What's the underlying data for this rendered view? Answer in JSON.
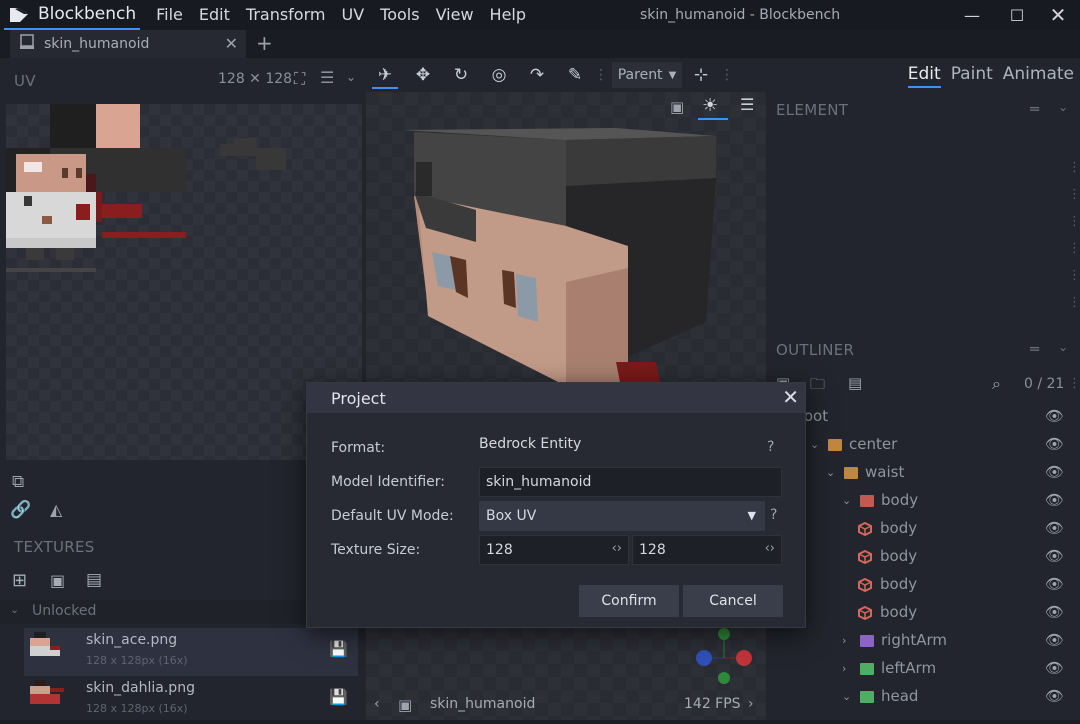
{
  "app": {
    "name": "Blockbench",
    "window_title": "skin_humanoid - Blockbench",
    "menu": [
      "File",
      "Edit",
      "Transform",
      "UV",
      "Tools",
      "View",
      "Help"
    ],
    "accent": "#3e90ff"
  },
  "tab": {
    "label": "skin_humanoid"
  },
  "uv_panel": {
    "title": "UV",
    "size": "128 ✕ 128"
  },
  "toolbar": {
    "pivot_select": "Parent"
  },
  "modes": {
    "edit": "Edit",
    "paint": "Paint",
    "animate": "Animate"
  },
  "element_panel": {
    "title": "ELEMENT"
  },
  "outliner": {
    "title": "OUTLINER",
    "count": "0 / 21",
    "rows": [
      {
        "label": "root",
        "kind": "root",
        "level": 0
      },
      {
        "label": "center",
        "kind": "folder",
        "color": "#c2873f",
        "level": 1
      },
      {
        "label": "waist",
        "kind": "folder",
        "color": "#c2873f",
        "level": 2
      },
      {
        "label": "body",
        "kind": "folder",
        "color": "#c35a4f",
        "level": 3
      },
      {
        "label": "body",
        "kind": "cube",
        "color": "#d2685c",
        "level": 4
      },
      {
        "label": "body",
        "kind": "cube",
        "color": "#d2685c",
        "level": 4
      },
      {
        "label": "body",
        "kind": "cube",
        "color": "#d2685c",
        "level": 4
      },
      {
        "label": "body",
        "kind": "cube",
        "color": "#d2685c",
        "level": 4
      },
      {
        "label": "rightArm",
        "kind": "folder",
        "color": "#8c63c6",
        "level": 3
      },
      {
        "label": "leftArm",
        "kind": "folder",
        "color": "#4fae63",
        "level": 3
      },
      {
        "label": "head",
        "kind": "folder",
        "color": "#4fae63",
        "level": 3
      }
    ]
  },
  "textures": {
    "title": "TEXTURES",
    "group": "Unlocked",
    "items": [
      {
        "name": "skin_ace.png",
        "size": "128 x 128px (16x)"
      },
      {
        "name": "skin_dahlia.png",
        "size": "128 x 128px (16x)"
      }
    ]
  },
  "viewport": {
    "model_name": "skin_humanoid",
    "fps": "142 FPS"
  },
  "dialog": {
    "title": "Project",
    "format_label": "Format:",
    "format_value": "Bedrock Entity",
    "model_id_label": "Model Identifier:",
    "model_id_value": "skin_humanoid",
    "uv_mode_label": "Default UV Mode:",
    "uv_mode_value": "Box UV",
    "texture_size_label": "Texture Size:",
    "texture_width": "128",
    "texture_height": "128",
    "confirm": "Confirm",
    "cancel": "Cancel"
  }
}
